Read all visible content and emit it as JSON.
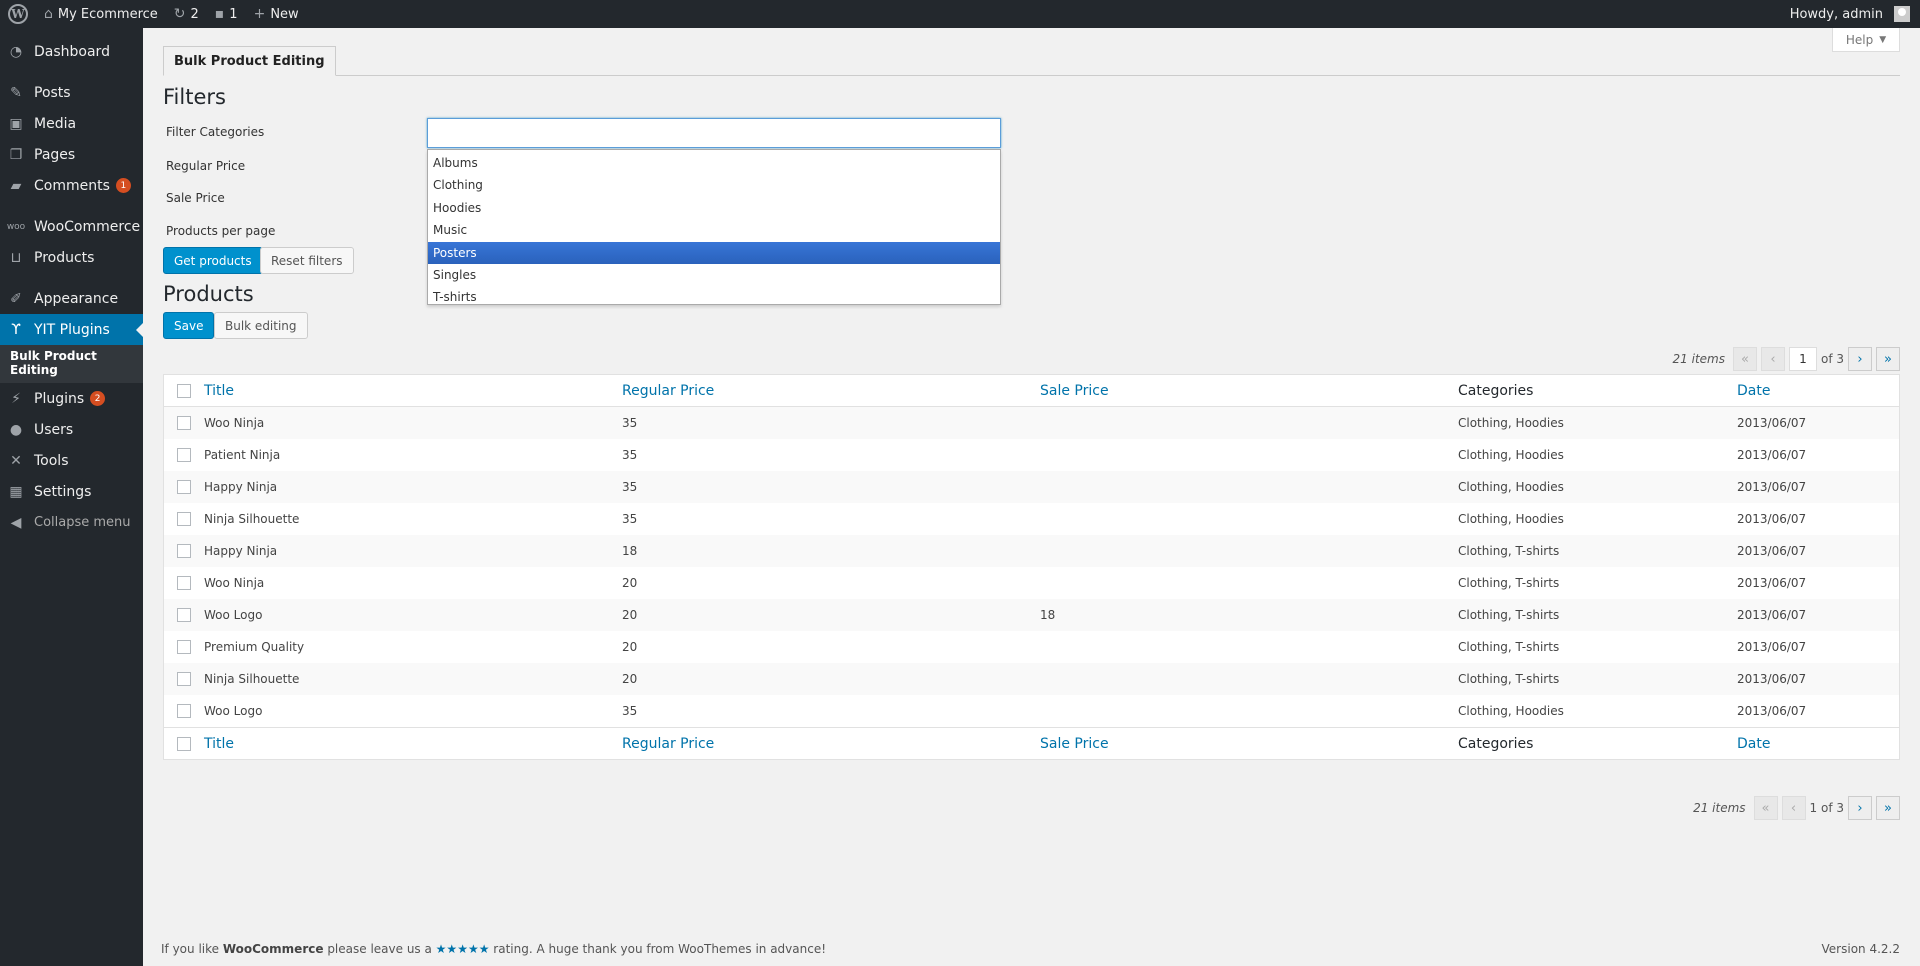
{
  "adminbar": {
    "site_name": "My Ecommerce",
    "updates_count": "2",
    "comments_count": "1",
    "new_label": "New",
    "howdy": "Howdy, admin"
  },
  "sidebar": {
    "items": [
      {
        "label": "Dashboard",
        "icon": "dashboard-icon"
      },
      {
        "label": "Posts",
        "icon": "pin-icon"
      },
      {
        "label": "Media",
        "icon": "media-icon"
      },
      {
        "label": "Pages",
        "icon": "pages-icon"
      },
      {
        "label": "Comments",
        "icon": "comment-icon",
        "badge": "1"
      },
      {
        "label": "WooCommerce",
        "icon": "woocommerce-icon"
      },
      {
        "label": "Products",
        "icon": "cart-icon"
      },
      {
        "label": "Appearance",
        "icon": "brush-icon"
      },
      {
        "label": "YIT Plugins",
        "icon": "yit-icon"
      },
      {
        "label": "Plugins",
        "icon": "plugin-icon",
        "badge": "2"
      },
      {
        "label": "Users",
        "icon": "users-icon"
      },
      {
        "label": "Tools",
        "icon": "wrench-icon"
      },
      {
        "label": "Settings",
        "icon": "settings-icon"
      }
    ],
    "submenu_item": "Bulk Product Editing",
    "collapse_label": "Collapse menu"
  },
  "help_label": "Help",
  "tab_label": "Bulk Product Editing",
  "filters": {
    "heading": "Filters",
    "labels": [
      "Filter Categories",
      "Regular Price",
      "Sale Price",
      "Products per page"
    ],
    "get_products": "Get products",
    "reset_filters": "Reset filters",
    "category_input_value": "",
    "category_options": [
      "Albums",
      "Clothing",
      "Hoodies",
      "Music",
      "Posters",
      "Singles",
      "T-shirts"
    ],
    "highlighted_option": "Posters"
  },
  "products": {
    "heading": "Products",
    "save": "Save",
    "bulk_editing": "Bulk editing"
  },
  "pagination_top": {
    "count": "21 items",
    "first": "«",
    "prev": "‹",
    "current": "1",
    "of": "of 3",
    "next": "›",
    "last": "»"
  },
  "pagination_bottom": {
    "count": "21 items",
    "first": "«",
    "prev": "‹",
    "current": "1 of 3",
    "next": "›",
    "last": "»"
  },
  "table": {
    "columns": [
      "Title",
      "Regular Price",
      "Sale Price",
      "Categories",
      "Date"
    ],
    "rows": [
      {
        "title": "Woo Ninja",
        "regular": "35",
        "sale": "",
        "categories": "Clothing, Hoodies",
        "date": "2013/06/07"
      },
      {
        "title": "Patient Ninja",
        "regular": "35",
        "sale": "",
        "categories": "Clothing, Hoodies",
        "date": "2013/06/07"
      },
      {
        "title": "Happy Ninja",
        "regular": "35",
        "sale": "",
        "categories": "Clothing, Hoodies",
        "date": "2013/06/07"
      },
      {
        "title": "Ninja Silhouette",
        "regular": "35",
        "sale": "",
        "categories": "Clothing, Hoodies",
        "date": "2013/06/07"
      },
      {
        "title": "Happy Ninja",
        "regular": "18",
        "sale": "",
        "categories": "Clothing, T-shirts",
        "date": "2013/06/07"
      },
      {
        "title": "Woo Ninja",
        "regular": "20",
        "sale": "",
        "categories": "Clothing, T-shirts",
        "date": "2013/06/07"
      },
      {
        "title": "Woo Logo",
        "regular": "20",
        "sale": "18",
        "categories": "Clothing, T-shirts",
        "date": "2013/06/07"
      },
      {
        "title": "Premium Quality",
        "regular": "20",
        "sale": "",
        "categories": "Clothing, T-shirts",
        "date": "2013/06/07"
      },
      {
        "title": "Ninja Silhouette",
        "regular": "20",
        "sale": "",
        "categories": "Clothing, T-shirts",
        "date": "2013/06/07"
      },
      {
        "title": "Woo Logo",
        "regular": "35",
        "sale": "",
        "categories": "Clothing, Hoodies",
        "date": "2013/06/07"
      }
    ]
  },
  "footer": {
    "text_1": "If you like ",
    "brand": "WooCommerce",
    "text_2": " please leave us a ",
    "stars": "★★★★★",
    "text_3": " rating. A huge thank you from WooThemes in advance!",
    "version": "Version 4.2.2"
  },
  "colors": {
    "accent": "#0073aa",
    "admin_bg": "#23282d",
    "primary_button": "#0091cd",
    "highlight": "#3875d7",
    "badge": "#d54e21"
  }
}
